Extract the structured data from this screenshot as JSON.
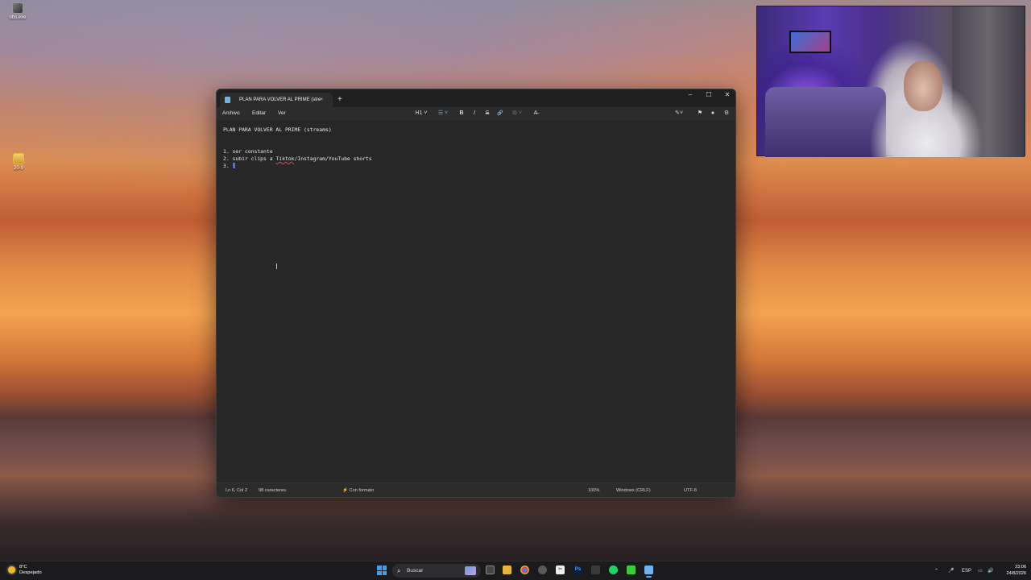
{
  "desktop": {
    "icons": [
      {
        "label": "obs.exe"
      },
      {
        "label": "20-9"
      }
    ]
  },
  "window": {
    "tab_title": "PLAN PARA VOLVER AL PRIME (stre",
    "tab_close": "×",
    "new_tab": "+",
    "controls": {
      "minimize": "–",
      "maximize": "☐",
      "close": "✕"
    },
    "menu": [
      "Archivo",
      "Editar",
      "Ver"
    ],
    "toolbar": {
      "heading": "H1",
      "list": "☰",
      "bold": "B",
      "italic": "I",
      "strike": "S",
      "link": "🔗",
      "table": "⊞",
      "clear": "A̶"
    },
    "editor": {
      "lines": [
        "PLAN PARA VOLVER AL PRIME (streams)",
        "",
        "",
        "1. ser constante",
        "2. subir clips a Tiktok/Instagram/YouTube shorts",
        "3. "
      ],
      "misspelled_word": "Tiktok"
    },
    "status": {
      "position": "Ln 6, Col 2",
      "chars": "98 caracteres.",
      "format": "Con formato",
      "zoom": "100%",
      "line_ending": "Windows (CRLF)",
      "encoding": "UTF-8"
    }
  },
  "taskbar": {
    "weather": {
      "temp": "8°C",
      "condition": "Despejado"
    },
    "search_placeholder": "Buscar",
    "tray": {
      "language": "ESP"
    },
    "clock": {
      "time": "23:06",
      "date": "24/8/2026"
    }
  }
}
